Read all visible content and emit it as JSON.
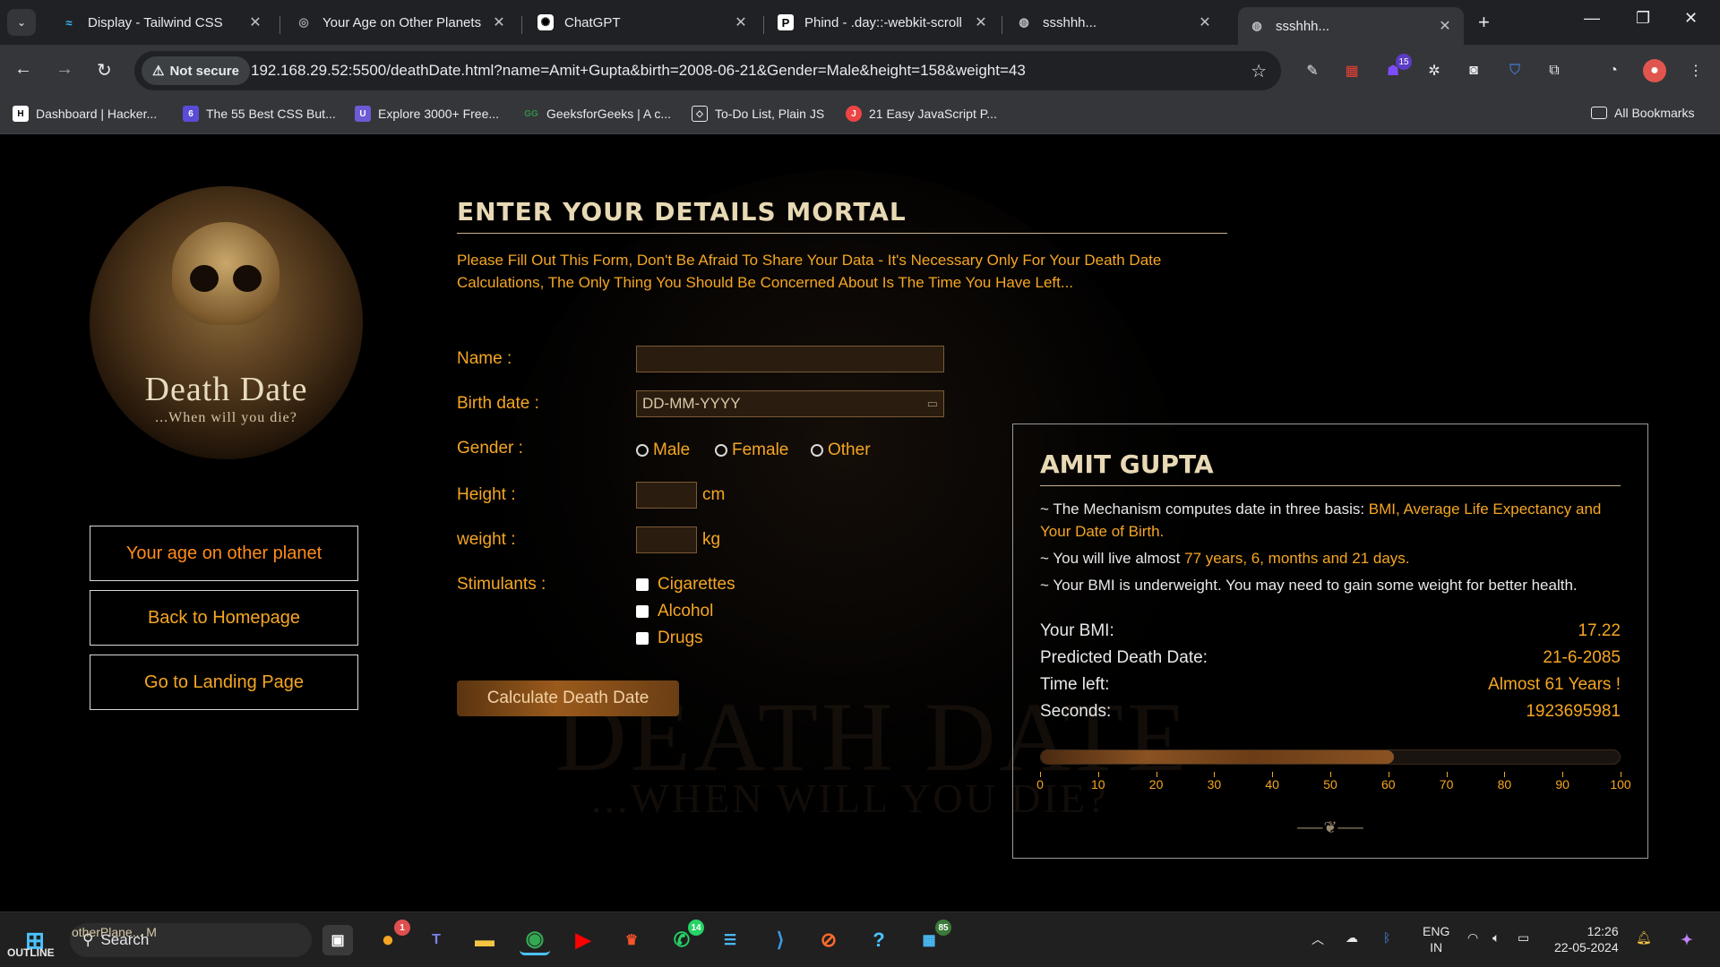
{
  "browser": {
    "tabs": [
      {
        "title": "Display - Tailwind CSS",
        "icon": "tailwind-icon"
      },
      {
        "title": "Your Age on Other Planets",
        "icon": "planet-icon"
      },
      {
        "title": "ChatGPT",
        "icon": "chatgpt-icon"
      },
      {
        "title": "Phind - .day::-webkit-scroll",
        "icon": "phind-icon"
      },
      {
        "title": "ssshhh...",
        "icon": "globe-icon"
      },
      {
        "title": "ssshhh...",
        "icon": "globe-icon"
      }
    ],
    "active_tab": 5,
    "security_label": "Not secure",
    "url": "192.168.29.52:5500/deathDate.html?name=Amit+Gupta&birth=2008-06-21&Gender=Male&height=158&weight=43",
    "extension_badge": "15",
    "bookmarks": [
      "Dashboard | Hacker...",
      "The 55 Best CSS But...",
      "Explore 3000+ Free...",
      "GeeksforGeeks | A c...",
      "To-Do List, Plain JS",
      "21 Easy JavaScript P..."
    ],
    "all_bookmarks": "All Bookmarks"
  },
  "page": {
    "logo": {
      "title": "Death Date",
      "subtitle": "...When will you die?"
    },
    "nav": [
      "Your age on other planet",
      "Back to Homepage",
      "Go to Landing Page"
    ],
    "bg_watermark": {
      "title": "DEATH DATE",
      "subtitle": "...WHEN WILL YOU DIE?"
    },
    "form": {
      "title": "ENTER YOUR DETAILS MORTAL",
      "intro": "Please Fill Out This Form, Don't Be Afraid To Share Your Data - It's Necessary Only For Your Death Date Calculations, The Only Thing You Should Be Concerned About Is The Time You Have Left...",
      "name_label": "Name :",
      "name_value": "",
      "birth_label": "Birth date :",
      "birth_placeholder": "DD-MM-YYYY",
      "gender_label": "Gender :",
      "gender_options": [
        "Male",
        "Female",
        "Other"
      ],
      "height_label": "Height :",
      "height_unit": "cm",
      "weight_label": "weight :",
      "weight_unit": "kg",
      "stimulants_label": "Stimulants :",
      "stimulants": [
        "Cigarettes",
        "Alcohol",
        "Drugs"
      ],
      "submit": "Calculate Death Date"
    },
    "result": {
      "name": "AMIT GUPTA",
      "line1_prefix": "~ The Mechanism computes date in three basis: ",
      "line1_highlight": "BMI, Average Life Expectancy and Your Date of Birth.",
      "line2_prefix": "~ You will live almost ",
      "line2_highlight": "77 years, 6, months and 21 days.",
      "line3": "~ Your BMI is underweight. You may need to gain some weight for better health.",
      "stats": [
        {
          "label": "Your BMI:",
          "value": "17.22"
        },
        {
          "label": "Predicted Death Date:",
          "value": "21-6-2085"
        },
        {
          "label": "Time left:",
          "value": "Almost 61 Years !"
        },
        {
          "label": "Seconds:",
          "value": "1923695981"
        }
      ],
      "progress_value": 61,
      "progress_max": 100,
      "scale_labels": [
        "0",
        "10",
        "20",
        "30",
        "40",
        "50",
        "60",
        "70",
        "80",
        "90",
        "100"
      ]
    }
  },
  "taskbar": {
    "search_placeholder": "Search",
    "outline_label": "OUTLINE",
    "otherplane_label": "otherPlane...  M",
    "badges": {
      "orange": "1",
      "whatsapp": "14",
      "store": "85"
    },
    "lang": {
      "top": "ENG",
      "bottom": "IN"
    },
    "time": "12:26",
    "date": "22-05-2024"
  }
}
